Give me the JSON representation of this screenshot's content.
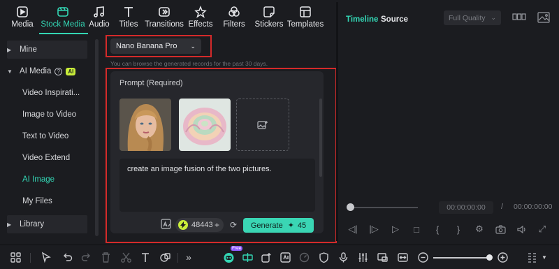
{
  "top_tools": [
    {
      "label": "Media",
      "icon": "media-icon"
    },
    {
      "label": "Stock Media",
      "icon": "stock-media-icon"
    },
    {
      "label": "Audio",
      "icon": "music-note-icon"
    },
    {
      "label": "Titles",
      "icon": "titles-icon"
    },
    {
      "label": "Transitions",
      "icon": "transitions-icon"
    },
    {
      "label": "Effects",
      "icon": "effects-star-icon"
    },
    {
      "label": "Filters",
      "icon": "filters-icon"
    },
    {
      "label": "Stickers",
      "icon": "stickers-icon"
    },
    {
      "label": "Templates",
      "icon": "templates-icon"
    }
  ],
  "sidebar": {
    "mine": "Mine",
    "ai_media": "AI Media",
    "ai_badge": "AI",
    "items": [
      "Video Inspirati...",
      "Image to Video",
      "Text to Video",
      "Video Extend",
      "AI Image",
      "My Files"
    ],
    "library": "Library"
  },
  "model": {
    "selected": "Nano Banana Pro",
    "hint": "You can browse the generated records for the past 30 days."
  },
  "prompt": {
    "label": "Prompt (Required)",
    "text": "create an image fusion of the two pictures.",
    "credits": "48443",
    "generate_label": "Generate",
    "generate_cost": "45"
  },
  "right": {
    "tab_timeline": "Timeline",
    "tab_source": "Source",
    "quality": "Full Quality",
    "current_time": "00:00:00:00",
    "separator": "/",
    "total_time": "00:00:00:00"
  },
  "bottom": {
    "free_badge": "Free"
  },
  "colors": {
    "accent": "#33d6b4",
    "highlight_box": "#d42a2a",
    "ai_badge": "#c9ee3a"
  }
}
